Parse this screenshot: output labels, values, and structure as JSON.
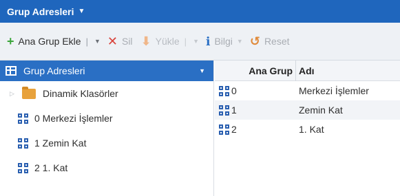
{
  "title_bar": {
    "title": "Grup Adresleri",
    "caret": "▼"
  },
  "toolbar": {
    "add_group_label": "Ana Grup Ekle",
    "separator": "|",
    "delete_label": "Sil",
    "load_label": "Yükle",
    "info_label": "Bilgi",
    "reset_label": "Reset",
    "caret": "▼"
  },
  "left_panel": {
    "header": "Grup Adresleri",
    "tree": [
      {
        "label": "Dinamik Klasörler",
        "type": "folder"
      },
      {
        "label": "0 Merkezi İşlemler",
        "type": "group"
      },
      {
        "label": "1 Zemin Kat",
        "type": "group"
      },
      {
        "label": "2 1. Kat",
        "type": "group"
      }
    ]
  },
  "grid": {
    "columns": [
      "Ana Grup",
      "Adı"
    ],
    "rows": [
      {
        "num": "0",
        "name": "Merkezi İşlemler"
      },
      {
        "num": "1",
        "name": "Zemin Kat"
      },
      {
        "num": "2",
        "name": "1. Kat"
      }
    ]
  },
  "colors": {
    "title_bar": "#1f66bd",
    "add_icon": "#3aa53a",
    "delete_icon": "#d9423a",
    "group_icon": "#2a5fb0",
    "folder": "#e8a23c"
  }
}
